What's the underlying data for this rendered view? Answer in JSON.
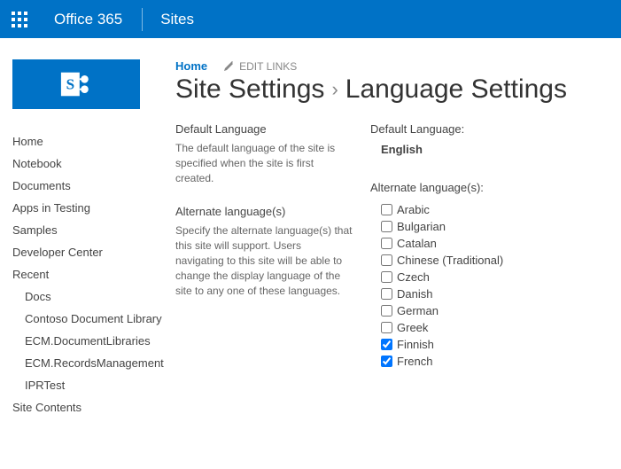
{
  "topbar": {
    "brand": "Office 365",
    "app": "Sites"
  },
  "breadcrumb": {
    "home": "Home",
    "edit_links": "EDIT LINKS",
    "site_settings": "Site Settings",
    "page_title": "Language Settings"
  },
  "nav": {
    "items": [
      "Home",
      "Notebook",
      "Documents",
      "Apps in Testing",
      "Samples",
      "Developer Center",
      "Recent"
    ],
    "recent_items": [
      "Docs",
      "Contoso Document Library",
      "ECM.DocumentLibraries",
      "ECM.RecordsManagement",
      "IPRTest"
    ],
    "footer": "Site Contents"
  },
  "sections": {
    "default_lang": {
      "heading": "Default Language",
      "desc": "The default language of the site is specified when the site is first created.",
      "label": "Default Language:",
      "value": "English"
    },
    "alt_lang": {
      "heading": "Alternate language(s)",
      "desc": "Specify the alternate language(s) that this site will support. Users navigating to this site will be able to change the display language of the site to any one of these languages.",
      "label": "Alternate language(s):",
      "options": [
        {
          "label": "Arabic",
          "checked": false
        },
        {
          "label": "Bulgarian",
          "checked": false
        },
        {
          "label": "Catalan",
          "checked": false
        },
        {
          "label": "Chinese (Traditional)",
          "checked": false
        },
        {
          "label": "Czech",
          "checked": false
        },
        {
          "label": "Danish",
          "checked": false
        },
        {
          "label": "German",
          "checked": false
        },
        {
          "label": "Greek",
          "checked": false
        },
        {
          "label": "Finnish",
          "checked": true
        },
        {
          "label": "French",
          "checked": true
        }
      ]
    }
  }
}
